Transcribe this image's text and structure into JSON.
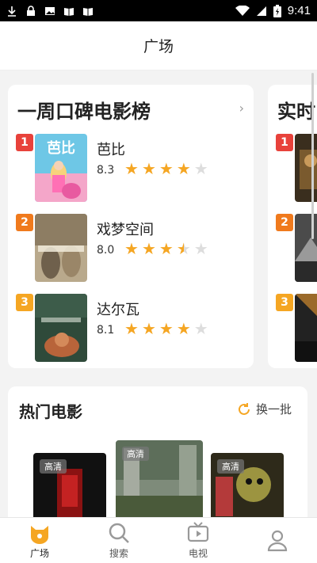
{
  "status_bar": {
    "time": "9:41"
  },
  "header": {
    "title": "广场"
  },
  "ranking": {
    "title": "一周口碑电影榜",
    "more": "›",
    "items": [
      {
        "rank": "1",
        "name": "芭比",
        "score": "8.3",
        "stars": 4,
        "badge_color": "#e8423b"
      },
      {
        "rank": "2",
        "name": "戏梦空间",
        "score": "8.0",
        "stars": 3.5,
        "badge_color": "#f07a1d"
      },
      {
        "rank": "3",
        "name": "达尔瓦",
        "score": "8.1",
        "stars": 4,
        "badge_color": "#f5a623"
      }
    ]
  },
  "realtime": {
    "title": "实时",
    "badges": [
      "1",
      "2",
      "3"
    ]
  },
  "hot": {
    "title": "热门电影",
    "refresh_label": "换一批",
    "tags": [
      "高清",
      "高清",
      "高清"
    ]
  },
  "tabs": [
    {
      "label": "广场",
      "icon": "cat-face-icon",
      "active": true
    },
    {
      "label": "搜索",
      "icon": "search-icon",
      "active": false
    },
    {
      "label": "电视",
      "icon": "tv-icon",
      "active": false
    },
    {
      "label": "",
      "icon": "profile-icon",
      "active": false
    }
  ],
  "colors": {
    "accent": "#f5a623",
    "rank1": "#e8423b",
    "rank2": "#f07a1d",
    "rank3": "#f5a623"
  }
}
